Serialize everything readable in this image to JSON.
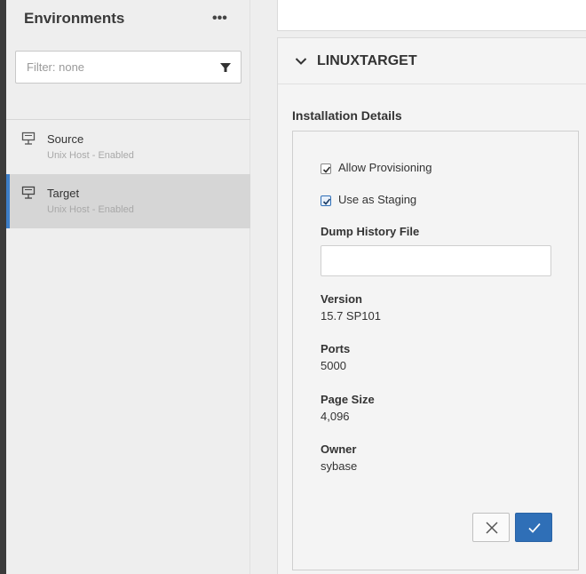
{
  "sidebar": {
    "title": "Environments",
    "more_label": "•••",
    "filter": {
      "placeholder": "Filter: none"
    },
    "items": [
      {
        "name": "Source",
        "subtitle": "Unix Host - Enabled",
        "selected": false
      },
      {
        "name": "Target",
        "subtitle": "Unix Host - Enabled",
        "selected": true
      }
    ]
  },
  "panel": {
    "title": "LINUXTARGET",
    "section_title": "Installation Details",
    "checkboxes": [
      {
        "label": "Allow Provisioning",
        "checked": true
      },
      {
        "label": "Use as Staging",
        "checked": true
      }
    ],
    "dump_history_label": "Dump History File",
    "dump_history_value": "",
    "fields": [
      {
        "label": "Version",
        "value": "15.7 SP101"
      },
      {
        "label": "Ports",
        "value": "5000"
      },
      {
        "label": "Page Size",
        "value": "4,096"
      },
      {
        "label": "Owner",
        "value": "sybase"
      }
    ]
  },
  "colors": {
    "accent": "#2f6fb7",
    "selected_bg": "#d6d6d6",
    "selected_bar": "#3d7ec8"
  },
  "icons": [
    "filter-icon",
    "host-icon",
    "chevron-down-icon",
    "close-icon",
    "check-icon"
  ]
}
